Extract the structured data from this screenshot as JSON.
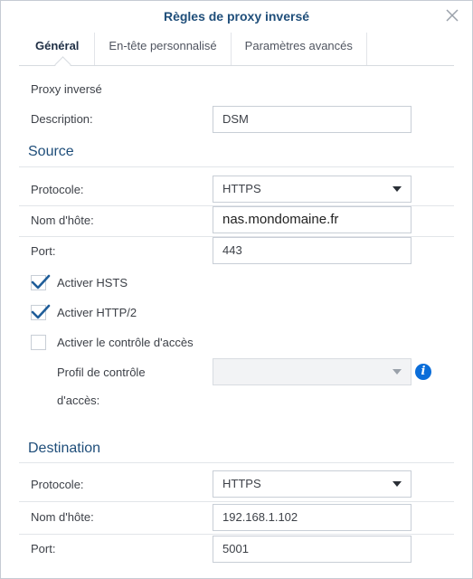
{
  "dialog": {
    "title": "Règles de proxy inversé"
  },
  "tabs": [
    {
      "label": "Général",
      "active": true
    },
    {
      "label": "En-tête personnalisé",
      "active": false
    },
    {
      "label": "Paramètres avancés",
      "active": false
    }
  ],
  "general": {
    "heading": "Proxy inversé",
    "description_label": "Description:",
    "description_value": "DSM"
  },
  "source": {
    "heading": "Source",
    "protocol_label": "Protocole:",
    "protocol_value": "HTTPS",
    "hostname_label": "Nom d'hôte:",
    "hostname_value": "nas.mondomaine.fr",
    "port_label": "Port:",
    "port_value": "443",
    "hsts_label": "Activer HSTS",
    "hsts_checked": true,
    "http2_label": "Activer HTTP/2",
    "http2_checked": true,
    "access_control_label": "Activer le contrôle d'accès",
    "access_control_checked": false,
    "access_profile_label_line1": "Profil de contrôle",
    "access_profile_label_line2": "d'accès:",
    "access_profile_value": "",
    "info_glyph": "i"
  },
  "destination": {
    "heading": "Destination",
    "protocol_label": "Protocole:",
    "protocol_value": "HTTPS",
    "hostname_label": "Nom d'hôte:",
    "hostname_value": "192.168.1.102",
    "port_label": "Port:",
    "port_value": "5001"
  },
  "colors": {
    "accent": "#1f4e7a",
    "check": "#1f5d99",
    "info": "#0a6dd9"
  }
}
